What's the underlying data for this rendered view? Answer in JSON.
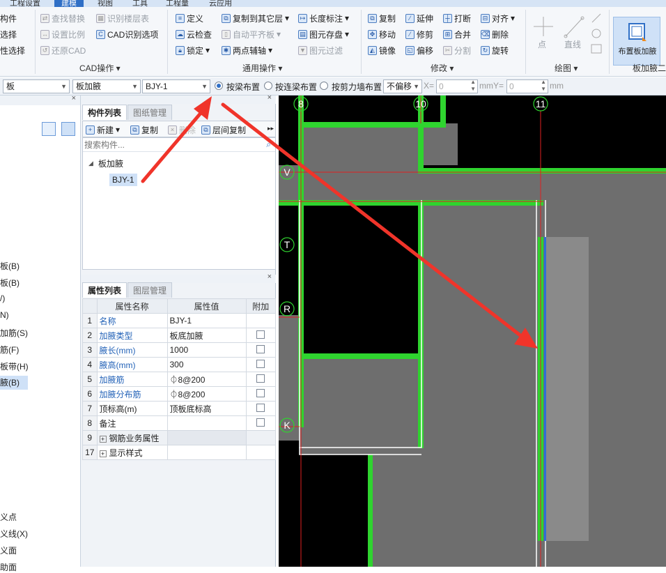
{
  "menu": {
    "items": [
      "工程设置",
      "建模",
      "视图",
      "工具",
      "工程量",
      "云应用"
    ],
    "active": "建模"
  },
  "ribbon": {
    "group_left": {
      "items": [
        "构件",
        "选择",
        "性选择"
      ]
    },
    "group_cad": {
      "name": "CAD操作",
      "items": [
        "查找替换",
        "设置比例",
        "还原CAD",
        "识别楼层表",
        "CAD识别选项"
      ]
    },
    "group_general": {
      "name": "通用操作",
      "items": [
        "定义",
        "云检查",
        "锁定",
        "复制到其它层",
        "自动平齐板",
        "两点辅轴",
        "长度标注",
        "图元存盘",
        "图元过滤"
      ]
    },
    "group_modify": {
      "name": "修改",
      "items": [
        "复制",
        "移动",
        "镜像",
        "延伸",
        "修剪",
        "偏移",
        "打断",
        "合并",
        "分割",
        "对齐",
        "删除",
        "旋转"
      ]
    },
    "group_draw": {
      "name": "绘图",
      "items": [
        "点",
        "直线"
      ]
    },
    "group_board": {
      "name": "板加腋二",
      "big_button": "布置板加腋"
    }
  },
  "toolbar2": {
    "combo1": "板",
    "combo2": "板加腋",
    "combo3": "BJY-1",
    "radio1": "按梁布置",
    "radio2": "按连梁布置",
    "radio3": "按剪力墙布置",
    "offset": "不偏移",
    "x_label": "X=",
    "x_value": "0",
    "y_unit": "mmY=",
    "y_value": "0",
    "mm": "mm"
  },
  "left_panel": {
    "items": [
      "板(B)",
      "板(B)",
      "/)",
      "N)",
      "加筋(S)",
      "筋(F)",
      "板带(H)",
      "腋(B)",
      "义点",
      "义线(X)",
      "义面",
      "助面"
    ],
    "selected": "腋(B)"
  },
  "component_panel": {
    "tabs": [
      "构件列表",
      "图纸管理"
    ],
    "toolbar": [
      "新建",
      "复制",
      "删除",
      "层间复制"
    ],
    "search_placeholder": "搜索构件...",
    "tree_root": "板加腋",
    "tree_child": "BJY-1"
  },
  "property_panel": {
    "tabs": [
      "属性列表",
      "图层管理"
    ],
    "headers": [
      "属性名称",
      "属性值",
      "附加"
    ],
    "rows": [
      {
        "n": "1",
        "name": "名称",
        "value": "BJY-1",
        "blue": true,
        "cb": false
      },
      {
        "n": "2",
        "name": "加腋类型",
        "value": "板底加腋",
        "blue": true,
        "cb": true
      },
      {
        "n": "3",
        "name": "腋长(mm)",
        "value": "1000",
        "blue": true,
        "cb": true
      },
      {
        "n": "4",
        "name": "腋高(mm)",
        "value": "300",
        "blue": true,
        "cb": true
      },
      {
        "n": "5",
        "name": "加腋筋",
        "value": "⏀8@200",
        "blue": true,
        "cb": true
      },
      {
        "n": "6",
        "name": "加腋分布筋",
        "value": "⏀8@200",
        "blue": true,
        "cb": true
      },
      {
        "n": "7",
        "name": "顶标高(m)",
        "value": "顶板底标高",
        "blue": false,
        "cb": true
      },
      {
        "n": "8",
        "name": "备注",
        "value": "",
        "blue": false,
        "cb": true
      },
      {
        "n": "9",
        "name": "钢筋业务属性",
        "value": "",
        "blue": false,
        "cb": false,
        "expand": true
      },
      {
        "n": "17",
        "name": "显示样式",
        "value": "",
        "blue": false,
        "cb": false,
        "expand": true
      }
    ]
  },
  "canvas": {
    "axis_top": [
      "8",
      "10",
      "11"
    ],
    "axis_left": [
      "V",
      "T",
      "R",
      "K"
    ]
  },
  "colors": {
    "beam": "#2fd42f",
    "slab": "#6e6e6e",
    "grid_red": "#e02020",
    "arrow": "#f0342a",
    "haunch": "#8a8a8a",
    "blue_edge": "#2d6fd6"
  }
}
